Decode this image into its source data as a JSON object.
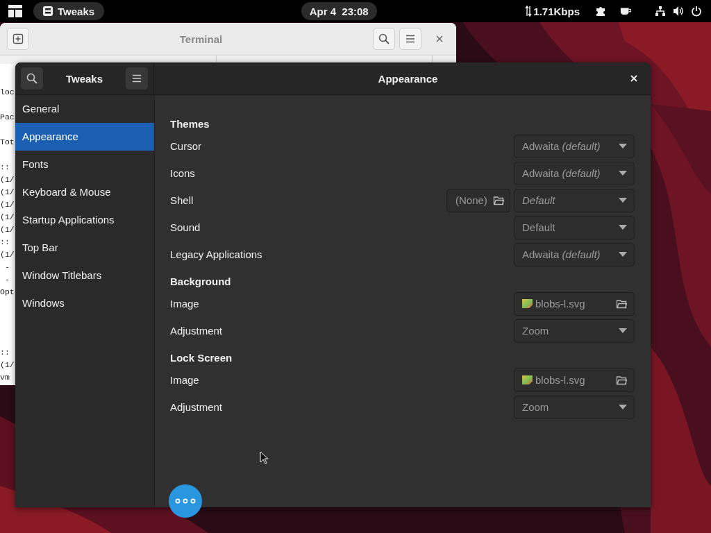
{
  "top_bar": {
    "app_menu": "Tweaks",
    "clock": "Apr 4  23:08",
    "network_speed": "1.71Kbps"
  },
  "terminal": {
    "title": "Terminal",
    "lines_top": [
      "loc",
      "Pac",
      "Tot",
      "::",
      "(1/",
      "(1/",
      "(1/",
      "(1/",
      "(1/",
      "::",
      "(1/",
      " -",
      " -",
      "Opt"
    ],
    "lines_bottom": [
      "::",
      "(1/",
      "vm"
    ]
  },
  "tweaks": {
    "sidebar_title": "Tweaks",
    "page_title": "Appearance",
    "sidebar_items": [
      {
        "label": "General",
        "selected": false
      },
      {
        "label": "Appearance",
        "selected": true
      },
      {
        "label": "Fonts",
        "selected": false
      },
      {
        "label": "Keyboard & Mouse",
        "selected": false
      },
      {
        "label": "Startup Applications",
        "selected": false
      },
      {
        "label": "Top Bar",
        "selected": false
      },
      {
        "label": "Window Titlebars",
        "selected": false
      },
      {
        "label": "Windows",
        "selected": false
      }
    ],
    "sections": [
      {
        "title": "Themes",
        "rows": [
          {
            "label": "Cursor",
            "kind": "dropdown",
            "value": "Adwaita *(default)*",
            "italic": false
          },
          {
            "label": "Icons",
            "kind": "dropdown",
            "value": "Adwaita *(default)*",
            "italic": false
          },
          {
            "label": "Shell",
            "kind": "shell",
            "file": "(None)",
            "value": "Default",
            "italic": true
          },
          {
            "label": "Sound",
            "kind": "dropdown",
            "value": "Default",
            "italic": false
          },
          {
            "label": "Legacy Applications",
            "kind": "dropdown",
            "value": "Adwaita *(default)*",
            "italic": false
          }
        ]
      },
      {
        "title": "Background",
        "rows": [
          {
            "label": "Image",
            "kind": "file",
            "value": "blobs-l.svg"
          },
          {
            "label": "Adjustment",
            "kind": "dropdown",
            "value": "Zoom",
            "italic": false
          }
        ]
      },
      {
        "title": "Lock Screen",
        "rows": [
          {
            "label": "Image",
            "kind": "file",
            "value": "blobs-l.svg"
          },
          {
            "label": "Adjustment",
            "kind": "dropdown",
            "value": "Zoom",
            "italic": false
          }
        ]
      }
    ]
  }
}
